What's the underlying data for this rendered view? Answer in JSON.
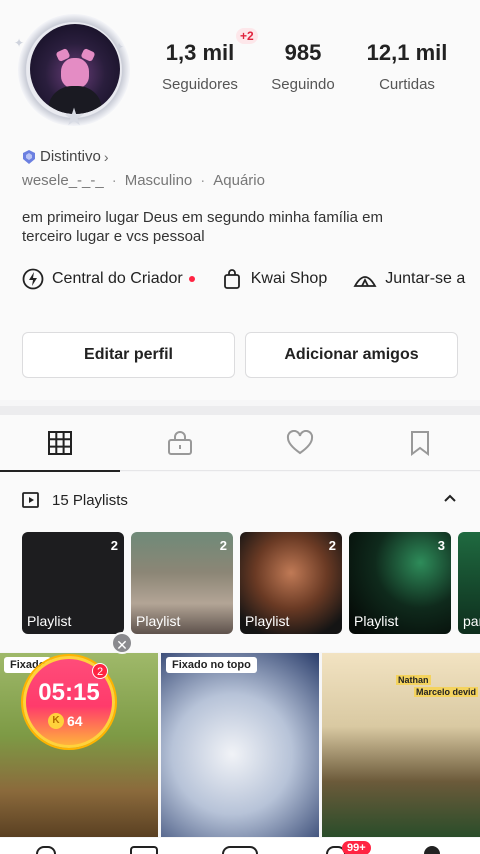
{
  "profile": {
    "stats": [
      {
        "value": "1,3 mil",
        "label": "Seguidores"
      },
      {
        "value": "985",
        "label": "Seguindo"
      },
      {
        "value": "12,1 mil",
        "label": "Curtidas"
      }
    ],
    "new_followers_badge": "+2",
    "badge_label": "Distintivo",
    "username": "wesele_-_-_",
    "gender": "Masculino",
    "sign": "Aquário",
    "bio": "em primeiro lugar Deus em segundo minha família em terceiro lugar e vcs pessoal"
  },
  "quick_links": [
    {
      "label": "Central do Criador",
      "icon": "lightning-icon",
      "has_dot": true
    },
    {
      "label": "Kwai Shop",
      "icon": "shopping-bag-icon",
      "has_dot": false
    },
    {
      "label": "Juntar-se a",
      "icon": "tent-icon",
      "has_dot": false
    }
  ],
  "buttons": {
    "edit_profile": "Editar perfil",
    "add_friends": "Adicionar amigos"
  },
  "tabs": [
    {
      "icon": "grid-icon",
      "active": true
    },
    {
      "icon": "lock-icon",
      "active": false
    },
    {
      "icon": "heart-icon",
      "active": false
    },
    {
      "icon": "bookmark-icon",
      "active": false
    }
  ],
  "playlists": {
    "header": "15 Playlists",
    "cards": [
      {
        "caption": "Playlist",
        "count": "2"
      },
      {
        "caption": "Playlist",
        "count": "2"
      },
      {
        "caption": "Playlist",
        "count": "2"
      },
      {
        "caption": "Playlist",
        "count": "3"
      },
      {
        "caption": "par",
        "count": ""
      }
    ]
  },
  "posts": [
    {
      "pinned_label": "Fixado"
    },
    {
      "pinned_label": "Fixado no topo"
    },
    {
      "overlay_texts": [
        "Nathan",
        "Marcelo devid"
      ]
    }
  ],
  "timer": {
    "time": "05:15",
    "coins": "64",
    "badge": "2",
    "coin_symbol": "K"
  },
  "bottom_nav": {
    "inbox_badge": "99+"
  },
  "colors": {
    "accent": "#ff2442",
    "text": "#222222"
  }
}
